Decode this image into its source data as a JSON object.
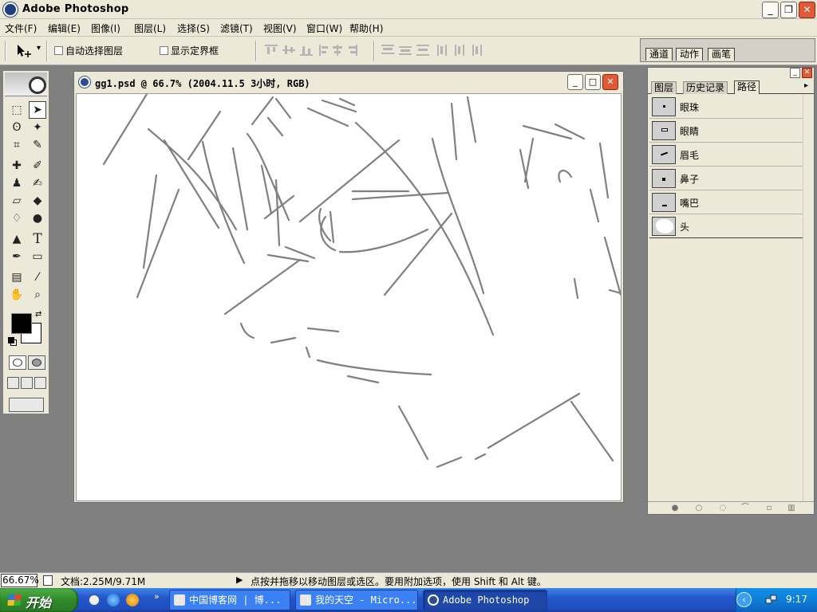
{
  "app": {
    "title": "Adobe Photoshop"
  },
  "window_buttons": {
    "minimize": "_",
    "restore": "❐",
    "close": "✕"
  },
  "menu": [
    "文件(F)",
    "编辑(E)",
    "图像(I)",
    "图层(L)",
    "选择(S)",
    "滤镜(T)",
    "视图(V)",
    "窗口(W)",
    "帮助(H)"
  ],
  "options_bar": {
    "tool_icon": "move-tool-icon",
    "tool_arrow": "▾",
    "auto_select_label": "自动选择图层",
    "auto_select_checked": false,
    "show_bounds_label": "显示定界框",
    "show_bounds_checked": false
  },
  "palette_well": {
    "tabs": [
      "通道",
      "动作",
      "画笔"
    ]
  },
  "document": {
    "title": "gg1.psd @ 66.7% (2004.11.5 3小时, RGB)",
    "buttons": {
      "minimize": "_",
      "maximize": "□",
      "close": "✕"
    }
  },
  "paths_palette": {
    "tabs": [
      "图层",
      "历史记录",
      "路径"
    ],
    "active_tab": "路径",
    "menu_arrow": "▸",
    "paths": [
      {
        "name": "眼珠",
        "thumb": "pupil-path-thumb"
      },
      {
        "name": "眼睛",
        "thumb": "eye-path-thumb"
      },
      {
        "name": "眉毛",
        "thumb": "eyebrow-path-thumb"
      },
      {
        "name": "鼻子",
        "thumb": "nose-path-thumb"
      },
      {
        "name": "嘴巴",
        "thumb": "mouth-path-thumb"
      },
      {
        "name": "头",
        "thumb": "head-path-thumb"
      }
    ]
  },
  "status": {
    "zoom": "66.67%",
    "doc_info": "文档:2.25M/9.71M",
    "arrow": "▶",
    "hint": "点按并拖移以移动图层或选区。要用附加选项，使用 Shift 和 Alt 键。"
  },
  "taskbar": {
    "start_label": "开始",
    "quick_launch_more": "»",
    "tasks": [
      {
        "label": "中国博客网 | 博...",
        "active": false
      },
      {
        "label": "我的天空 - Micro...",
        "active": false
      },
      {
        "label": "Adobe Photoshop",
        "active": true
      }
    ],
    "tray_expand": "‹",
    "clock": "9:17"
  },
  "colors": {
    "foreground": "#000000",
    "background": "#ffffff",
    "taskbar_blue": "#2456c9",
    "start_green": "#3a9a34",
    "chrome": "#ece9d8",
    "sketch_stroke": "#808080"
  }
}
